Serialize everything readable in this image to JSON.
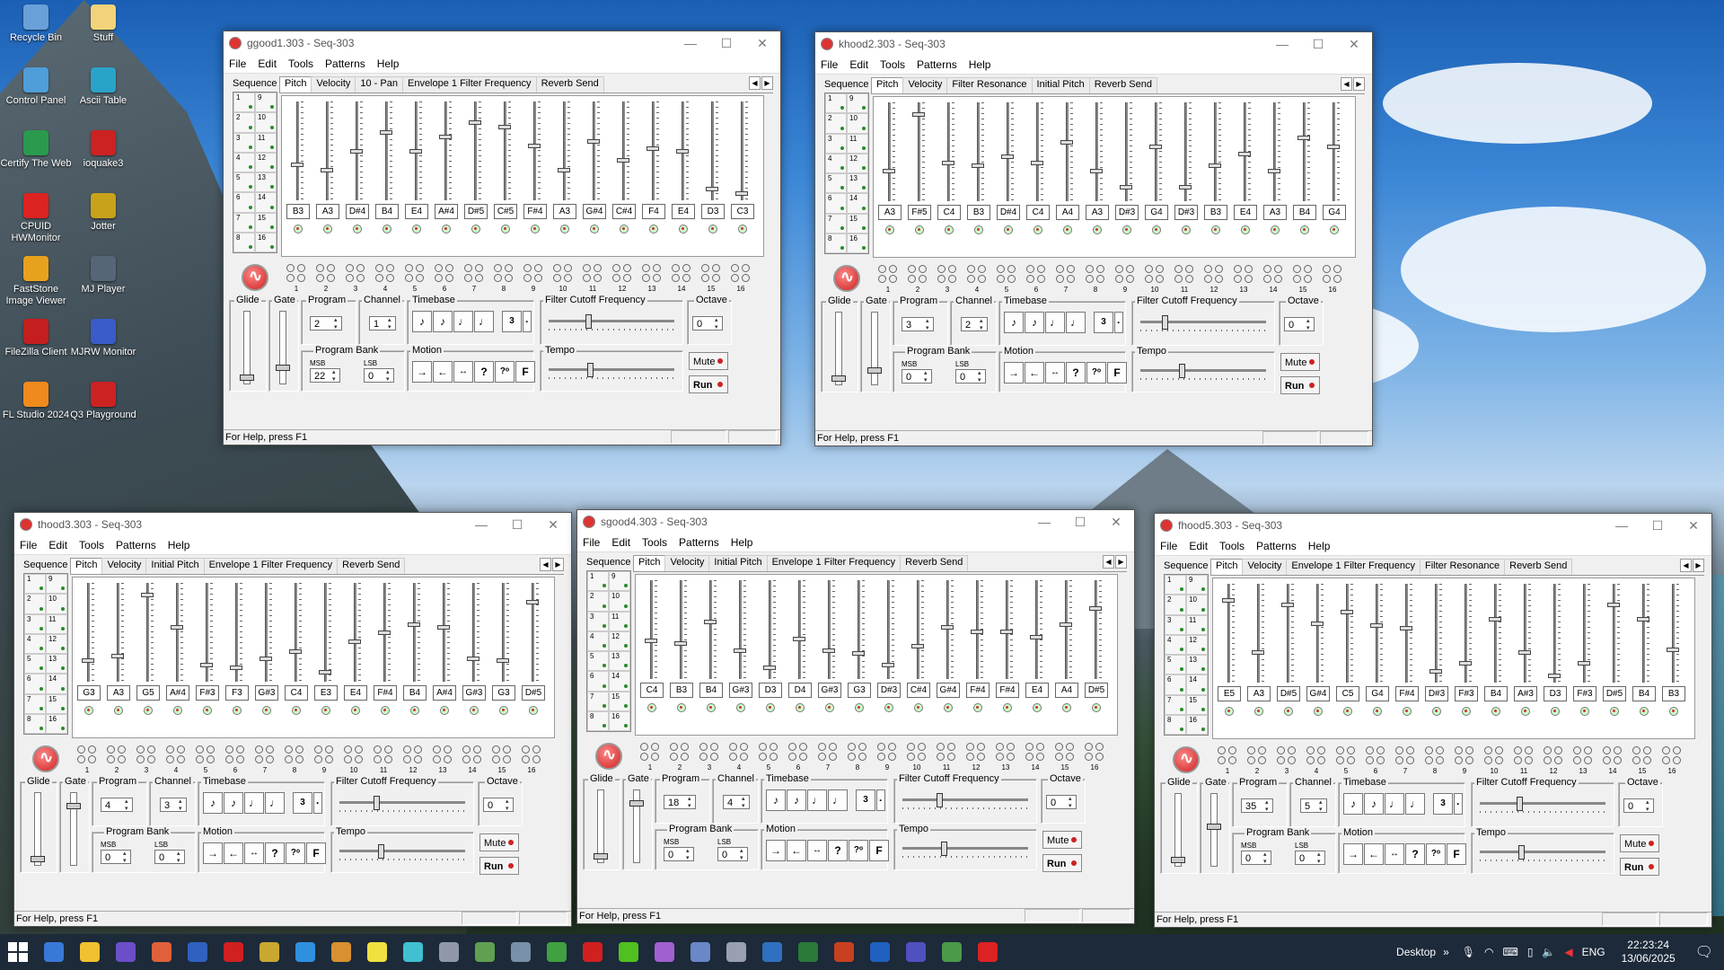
{
  "desktop": {
    "icons": [
      {
        "label": "Recycle Bin",
        "color": "#6aa0d8"
      },
      {
        "label": "Stuff",
        "color": "#f2d37a"
      },
      {
        "label": "Control Panel",
        "color": "#4f9ed9"
      },
      {
        "label": "Ascii Table",
        "color": "#2aa3c9"
      },
      {
        "label": "Certify The Web",
        "color": "#2a9a4e"
      },
      {
        "label": "ioquake3",
        "color": "#c22"
      },
      {
        "label": "CPUID HWMonitor",
        "color": "#d22"
      },
      {
        "label": "Jotter",
        "color": "#c8a21a"
      },
      {
        "label": "FastStone Image Viewer",
        "color": "#e8a11c"
      },
      {
        "label": "MJ Player",
        "color": "#556677"
      },
      {
        "label": "FileZilla Client",
        "color": "#c41e1e"
      },
      {
        "label": "MJRW Monitor",
        "color": "#3a5cc8"
      },
      {
        "label": "FL Studio 2024",
        "color": "#f08a1c"
      },
      {
        "label": "Q3 Playground",
        "color": "#c22"
      }
    ]
  },
  "menus": [
    "File",
    "Edit",
    "Tools",
    "Patterns",
    "Help"
  ],
  "labels": {
    "sequence": "Sequence",
    "glide": "Glide",
    "gate": "Gate",
    "program": "Program",
    "channel": "Channel",
    "timebase": "Timebase",
    "filter": "Filter Cutoff Frequency",
    "octave": "Octave",
    "program_bank": "Program Bank",
    "msb": "MSB",
    "lsb": "LSB",
    "motion": "Motion",
    "tempo": "Tempo",
    "mute": "Mute",
    "run": "Run",
    "status": "For Help, press F1"
  },
  "windows": [
    {
      "title": "ggood1.303 - Seq-303",
      "tabs": [
        "Pitch",
        "Velocity",
        "10 - Pan",
        "Envelope 1 Filter Frequency",
        "Reverb Send"
      ],
      "notes": [
        "B3",
        "A3",
        "D#4",
        "B4",
        "E4",
        "A#4",
        "D#5",
        "C#5",
        "F#4",
        "A3",
        "G#4",
        "C#4",
        "F4",
        "E4",
        "D3",
        "C3"
      ],
      "levels": [
        0.35,
        0.3,
        0.5,
        0.7,
        0.5,
        0.65,
        0.8,
        0.75,
        0.55,
        0.3,
        0.6,
        0.4,
        0.52,
        0.5,
        0.1,
        0.05
      ],
      "program": "2",
      "channel": "1",
      "octave": "0",
      "msb": "22",
      "lsb": "0",
      "filter_level": 0.3,
      "tempo_level": 0.32,
      "glide_level": 0.05,
      "gate_level": 0.2
    },
    {
      "title": "khood2.303 - Seq-303",
      "tabs": [
        "Pitch",
        "Velocity",
        "Filter Resonance",
        "Initial Pitch",
        "Reverb Send"
      ],
      "notes": [
        "A3",
        "F#5",
        "C4",
        "B3",
        "D#4",
        "C4",
        "A4",
        "A3",
        "D#3",
        "G4",
        "D#3",
        "B3",
        "E4",
        "A3",
        "B4",
        "G4"
      ],
      "levels": [
        0.3,
        0.9,
        0.38,
        0.35,
        0.45,
        0.38,
        0.6,
        0.3,
        0.12,
        0.55,
        0.12,
        0.35,
        0.48,
        0.3,
        0.65,
        0.55
      ],
      "program": "3",
      "channel": "2",
      "octave": "0",
      "msb": "0",
      "lsb": "0",
      "filter_level": 0.18,
      "tempo_level": 0.32,
      "glide_level": 0.05,
      "gate_level": 0.18
    },
    {
      "title": "thood3.303 - Seq-303",
      "tabs": [
        "Pitch",
        "Velocity",
        "Initial Pitch",
        "Envelope 1 Filter Frequency",
        "Reverb Send"
      ],
      "notes": [
        "G3",
        "A3",
        "G5",
        "A#4",
        "F#3",
        "F3",
        "G#3",
        "C4",
        "E3",
        "E4",
        "F#4",
        "B4",
        "A#4",
        "G#3",
        "G3",
        "D#5"
      ],
      "levels": [
        0.2,
        0.25,
        0.9,
        0.55,
        0.15,
        0.12,
        0.22,
        0.3,
        0.08,
        0.4,
        0.5,
        0.58,
        0.55,
        0.22,
        0.2,
        0.82
      ],
      "program": "4",
      "channel": "3",
      "octave": "0",
      "msb": "0",
      "lsb": "0",
      "filter_level": 0.28,
      "tempo_level": 0.32,
      "glide_level": 0.05,
      "gate_level": 0.85
    },
    {
      "title": "sgood4.303 - Seq-303",
      "tabs": [
        "Pitch",
        "Velocity",
        "Initial Pitch",
        "Envelope 1 Filter Frequency",
        "Reverb Send"
      ],
      "notes": [
        "C4",
        "B3",
        "B4",
        "G#3",
        "D3",
        "D4",
        "G#3",
        "G3",
        "D#3",
        "C#4",
        "G#4",
        "F#4",
        "F#4",
        "E4",
        "A4",
        "D#5"
      ],
      "levels": [
        0.38,
        0.35,
        0.58,
        0.28,
        0.1,
        0.4,
        0.28,
        0.25,
        0.12,
        0.32,
        0.52,
        0.48,
        0.48,
        0.42,
        0.55,
        0.72
      ],
      "program": "18",
      "channel": "4",
      "octave": "0",
      "msb": "0",
      "lsb": "0",
      "filter_level": 0.28,
      "tempo_level": 0.32,
      "glide_level": 0.05,
      "gate_level": 0.85
    },
    {
      "title": "fhood5.303 - Seq-303",
      "tabs": [
        "Pitch",
        "Velocity",
        "Envelope 1 Filter Frequency",
        "Filter Resonance",
        "Reverb Send"
      ],
      "notes": [
        "E5",
        "A3",
        "D#5",
        "G#4",
        "C5",
        "G4",
        "F#4",
        "D#3",
        "F#3",
        "B4",
        "A#3",
        "D3",
        "F#3",
        "D#5",
        "B4",
        "B3"
      ],
      "levels": [
        0.85,
        0.3,
        0.8,
        0.6,
        0.72,
        0.58,
        0.55,
        0.1,
        0.18,
        0.65,
        0.3,
        0.05,
        0.18,
        0.8,
        0.65,
        0.32
      ],
      "program": "35",
      "channel": "5",
      "octave": "0",
      "msb": "0",
      "lsb": "0",
      "filter_level": 0.3,
      "tempo_level": 0.32,
      "glide_level": 0.05,
      "gate_level": 0.55
    }
  ],
  "taskbar": {
    "desktop_label": "Desktop",
    "lang": "ENG",
    "time": "22:23:24",
    "date": "13/06/2025",
    "apps": [
      "#3a78d8",
      "#f0c030",
      "#6a4fc8",
      "#e0603a",
      "#3060c0",
      "#d02020",
      "#c8a830",
      "#3090e0",
      "#d89030",
      "#f0e040",
      "#40c0d0",
      "#9098a8",
      "#60a050",
      "#7890a8",
      "#40a040",
      "#d02020",
      "#50c020",
      "#a060d0",
      "#6a88c8",
      "#9aa0b0",
      "#3070c0",
      "#2a7a3a",
      "#c84020",
      "#2060c0",
      "#5050c0",
      "#4a9a4a",
      "#d22"
    ]
  }
}
